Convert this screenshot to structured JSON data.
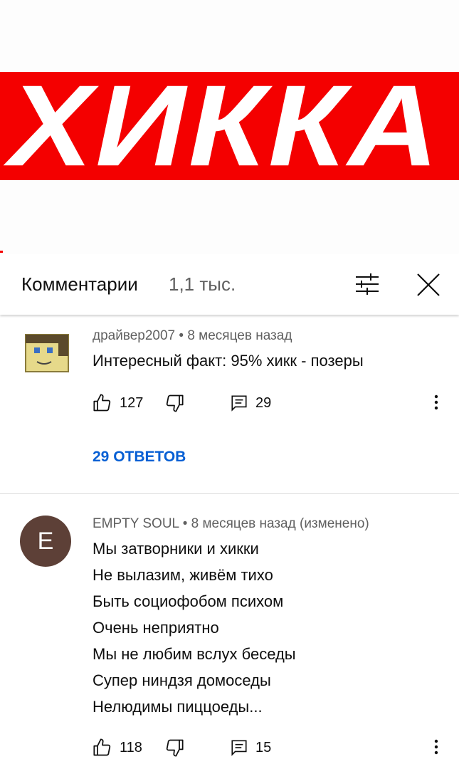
{
  "video": {
    "banner_text": "ХИККА",
    "banner_color": "#f40000"
  },
  "comments_header": {
    "title": "Комментарии",
    "count": "1,1 тыс.",
    "sort_icon": "sort-icon",
    "close_icon": "close-icon"
  },
  "comments": [
    {
      "author": "драйвер2007",
      "time": "8 месяцев назад",
      "meta": "драйвер2007 • 8 месяцев назад",
      "text": "Интересный факт: 95% хикк - позеры",
      "likes": "127",
      "replies_count": "29",
      "replies_link": "29 ОТВЕТОВ",
      "avatar": "pixel-character-avatar"
    },
    {
      "author": "EMPTY SOUL",
      "avatar_letter": "E",
      "avatar_color": "#5d4037",
      "meta": "EMPTY SOUL • 8 месяцев назад (изменено)",
      "text": "Мы затворники и хикки\nНе вылазим, живём тихо\nБыть социофобом психом\nОчень неприятно\nМы не любим вслух беседы\nСупер ниндзя домоседы\nНелюдимы пиццоеды...",
      "likes": "118",
      "replies_count": "15"
    }
  ],
  "colors": {
    "link": "#065fd4",
    "secondary_text": "#606060"
  }
}
